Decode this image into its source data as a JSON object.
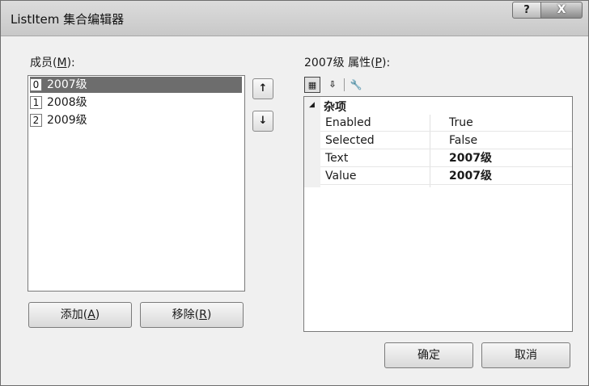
{
  "window": {
    "title": "ListItem 集合编辑器",
    "help_glyph": "?",
    "close_glyph": "X"
  },
  "members": {
    "label_prefix": "成员(",
    "label_key": "M",
    "label_suffix": "):",
    "items": [
      {
        "index": "0",
        "text": "2007级",
        "selected": true
      },
      {
        "index": "1",
        "text": "2008级",
        "selected": false
      },
      {
        "index": "2",
        "text": "2009级",
        "selected": false
      }
    ],
    "move_up_glyph": "↑",
    "move_down_glyph": "↓"
  },
  "buttons": {
    "add_prefix": "添加(",
    "add_key": "A",
    "add_suffix": ")",
    "remove_prefix": "移除(",
    "remove_key": "R",
    "remove_suffix": ")",
    "ok": "确定",
    "cancel": "取消"
  },
  "properties": {
    "label_prefix": "2007级 属性(",
    "label_key": "P",
    "label_suffix": "):",
    "toolbar": {
      "categorized_icon": "categorized-icon",
      "categorized_glyph": "▦",
      "alphabetical_icon": "alphabetical-sort-icon",
      "alphabetical_glyph": "⇩",
      "property_pages_icon": "wrench-icon",
      "property_pages_glyph": "🔧"
    },
    "category": "杂项",
    "collapse_glyph": "◢",
    "rows": [
      {
        "name": "Enabled",
        "value": "True",
        "bold": false
      },
      {
        "name": "Selected",
        "value": "False",
        "bold": false
      },
      {
        "name": "Text",
        "value": "2007级",
        "bold": true
      },
      {
        "name": "Value",
        "value": "2007级",
        "bold": true
      }
    ]
  }
}
